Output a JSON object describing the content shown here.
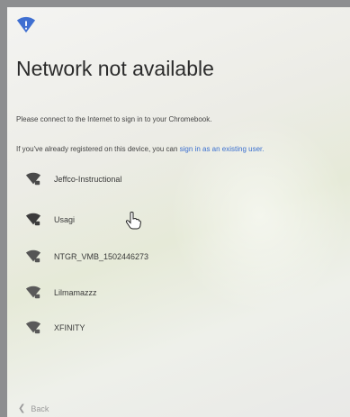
{
  "page": {
    "title": "Network not available",
    "message": "Please connect to the Internet to sign in to your Chromebook.",
    "existing_prefix": "If you've already registered on this device, you can ",
    "existing_link": "sign in as an existing user."
  },
  "networks": [
    {
      "name": "Jeffco-Instructional",
      "icon": "wifi-locked-icon"
    },
    {
      "name": "Usagi",
      "icon": "wifi-locked-icon"
    },
    {
      "name": "NTGR_VMB_1502446273",
      "icon": "wifi-locked-icon"
    },
    {
      "name": "Lilmamazzz",
      "icon": "wifi-locked-icon"
    },
    {
      "name": "XFINITY",
      "icon": "wifi-locked-icon"
    }
  ],
  "footer": {
    "back_label": "Back"
  },
  "colors": {
    "accent": "#3a6fcf",
    "logo": "#3f6fd1"
  }
}
